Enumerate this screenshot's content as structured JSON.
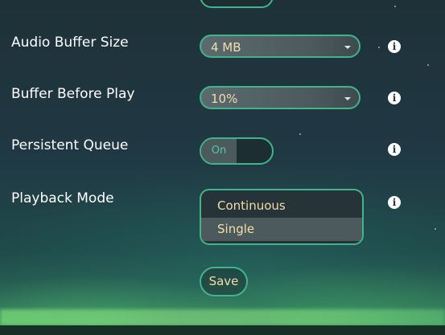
{
  "settings": {
    "audio_buffer_size": {
      "label": "Audio Buffer Size",
      "value": "4 MB"
    },
    "buffer_before_play": {
      "label": "Buffer Before Play",
      "value": "10%"
    },
    "persistent_queue": {
      "label": "Persistent Queue",
      "toggle_on_label": "On"
    },
    "playback_mode": {
      "label": "Playback Mode",
      "options": [
        "Continuous",
        "Single"
      ],
      "selected": "Single"
    }
  },
  "actions": {
    "save_label": "Save"
  },
  "icons": {
    "info": "info-icon",
    "caret": "caret-down-icon"
  },
  "colors": {
    "accent": "#43b38a",
    "value_text": "#f3dda8",
    "label_text": "#ffffff"
  }
}
